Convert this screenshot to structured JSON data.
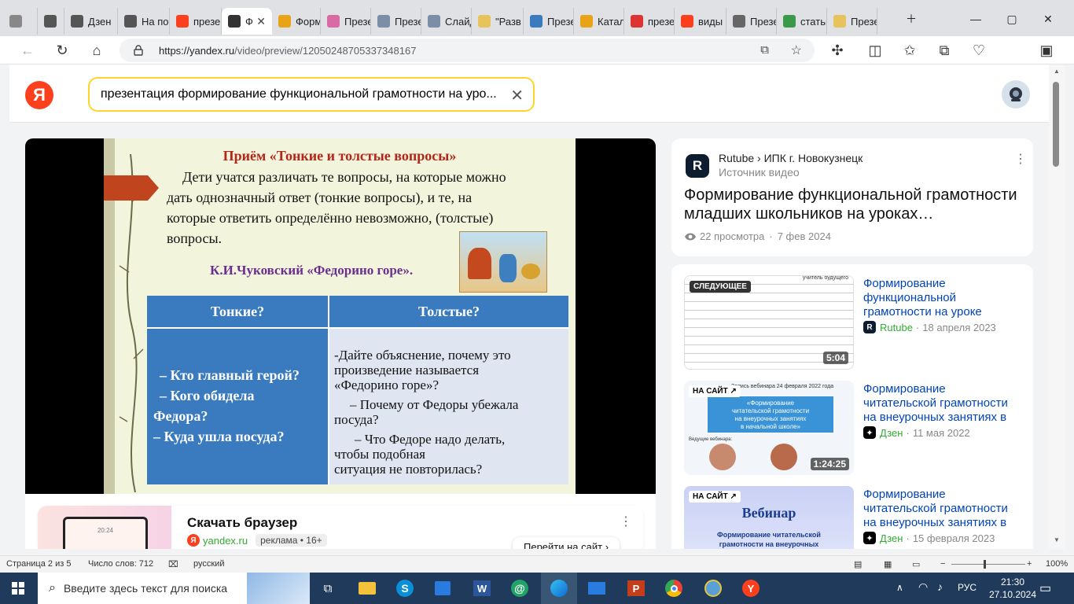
{
  "tabs": [
    {
      "label": "",
      "icon": "profile-icon"
    },
    {
      "label": "",
      "icon": "tab-actions-icon"
    },
    {
      "label": "Дзен",
      "icon": "dzen-icon"
    },
    {
      "label": "На по",
      "icon": "dzen-icon"
    },
    {
      "label": "презе",
      "icon": "yandex-icon"
    },
    {
      "label": "Ф",
      "icon": "audio-icon"
    },
    {
      "label": "Форм",
      "icon": "play-icon"
    },
    {
      "label": "Презе",
      "icon": "flower-icon"
    },
    {
      "label": "Презе",
      "icon": "slides-icon"
    },
    {
      "label": "Слайд",
      "icon": "slides-icon"
    },
    {
      "label": "\"Разв",
      "icon": "pen-icon"
    },
    {
      "label": "Презе",
      "icon": "book-icon"
    },
    {
      "label": "Катал",
      "icon": "play-icon"
    },
    {
      "label": "презе",
      "icon": "pdf-icon"
    },
    {
      "label": "виды",
      "icon": "yandex-icon"
    },
    {
      "label": "Презе",
      "icon": "page-icon"
    },
    {
      "label": "статьи",
      "icon": "check-icon"
    },
    {
      "label": "Презе",
      "icon": "pen-icon"
    }
  ],
  "address": {
    "url_host": "https://yandex.ru",
    "url_path": "/video/preview/12050248705337348167"
  },
  "search": {
    "query": "презентация формирование функциональной грамотности на уро..."
  },
  "logo": {
    "letter": "Я"
  },
  "slide": {
    "title": "Приём «Тонкие и толстые вопросы»",
    "text_lines": [
      "Дети учатся различать те вопросы, на которые можно",
      "дать однозначный ответ (тонкие вопросы), и те, на",
      "которые ответить определённо невозможно, (толстые)",
      "вопросы."
    ],
    "author": "К.И.Чуковский «Федорино горе».",
    "col1_header": "Тонкие?",
    "col2_header": "Толстые?",
    "col1_items": [
      "– Кто главный герой?",
      "– Кого обидела",
      "Федора?",
      "– Куда ушла посуда?"
    ],
    "col2_items": [
      "-Дайте объяснение, почему это",
      "произведение называется",
      "«Федорино горе»?",
      "– Почему от Федоры убежала",
      "посуда?",
      "– Что Федоре надо делать,",
      "чтобы подобная",
      "ситуация не повторилась?"
    ]
  },
  "ad": {
    "title": "Скачать браузер",
    "domain": "yandex.ru",
    "label": "реклама • 16+",
    "button": "Перейти на сайт",
    "clock": "20:24"
  },
  "source_card": {
    "platform": "Rutube",
    "channel": "ИПК г. Новокузнецк",
    "sublabel": "Источник видео",
    "title_line1": "Формирование функциональной грамотности",
    "title_line2": "младших школьников на уроках…",
    "views": "22 просмотра",
    "date": "7 фев 2024"
  },
  "related": [
    {
      "badge": "СЛЕДУЮЩЕЕ",
      "duration": "5:04",
      "title": [
        "Формирование",
        "функциональной",
        "грамотности на уроке"
      ],
      "source": "Rutube",
      "date": "18 апреля 2023",
      "thumb_caption": "учитель будущего"
    },
    {
      "badge": "НА САЙТ ↗",
      "duration": "1:24:25",
      "title": [
        "Формирование",
        "читательской грамотности",
        "на внеурочных занятиях в"
      ],
      "source": "Дзен",
      "date": "11 мая 2022",
      "thumb_caption": "Запись вебинара 24 февраля 2022 года",
      "thumb_box": [
        "«Формирование",
        "читательской грамотности",
        "на внеурочных занятиях",
        "в начальной школе»"
      ],
      "thumb_sub": "Ведущие вебинара:"
    },
    {
      "badge": "НА САЙТ ↗",
      "duration": "",
      "title": [
        "Формирование",
        "читательской грамотности",
        "на внеурочных занятиях в"
      ],
      "source": "Дзен",
      "date": "15 февраля 2023",
      "thumb_caption": "Вебинар",
      "thumb_box": [
        "Формирование читательской",
        "грамотности на внеурочных"
      ]
    }
  ],
  "statusbar": {
    "page": "Страница 2 из 5",
    "words": "Число слов: 712",
    "lang": "русский",
    "zoom": "100%"
  },
  "taskbar": {
    "search_placeholder": "Введите здесь текст для поиска",
    "lang": "РУС",
    "time": "21:30",
    "date": "27.10.2024"
  },
  "colors": {
    "accent_yellow": "#fed42b",
    "yandex_red": "#fc3f1d",
    "link_blue": "#0044bb",
    "taskbar": "#1f3a5a"
  }
}
